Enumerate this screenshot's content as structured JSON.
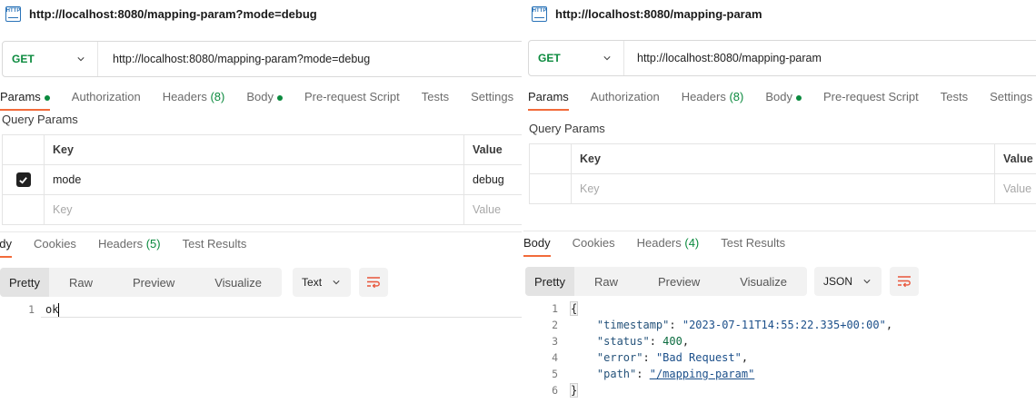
{
  "left": {
    "title": "http://localhost:8080/mapping-param?mode=debug",
    "method": "GET",
    "url": "http://localhost:8080/mapping-param?mode=debug",
    "request_tabs": [
      {
        "label": "Params",
        "dot": true
      },
      {
        "label": "Authorization"
      },
      {
        "label": "Headers",
        "count": "(8)"
      },
      {
        "label": "Body",
        "dot": true
      },
      {
        "label": "Pre-request Script"
      },
      {
        "label": "Tests"
      },
      {
        "label": "Settings"
      }
    ],
    "query_params_label": "Query Params",
    "table": {
      "key_header": "Key",
      "value_header": "Value",
      "rows": [
        {
          "key": "mode",
          "value": "debug",
          "checked": true
        }
      ],
      "key_placeholder": "Key",
      "value_placeholder": "Value"
    },
    "response_tabs": [
      {
        "label": "ody"
      },
      {
        "label": "Cookies"
      },
      {
        "label": "Headers",
        "count": "(5)"
      },
      {
        "label": "Test Results"
      }
    ],
    "view_modes": [
      "Pretty",
      "Raw",
      "Preview",
      "Visualize"
    ],
    "format": "Text",
    "body_lines": [
      {
        "n": "1",
        "text": "ok"
      }
    ]
  },
  "right": {
    "title": "http://localhost:8080/mapping-param",
    "method": "GET",
    "url": "http://localhost:8080/mapping-param",
    "request_tabs": [
      {
        "label": "Params"
      },
      {
        "label": "Authorization"
      },
      {
        "label": "Headers",
        "count": "(8)"
      },
      {
        "label": "Body",
        "dot": true
      },
      {
        "label": "Pre-request Script"
      },
      {
        "label": "Tests"
      },
      {
        "label": "Settings"
      }
    ],
    "query_params_label": "Query Params",
    "table": {
      "key_header": "Key",
      "value_header": "Value",
      "key_placeholder": "Key",
      "value_placeholder": "Value"
    },
    "response_tabs": [
      {
        "label": "Body"
      },
      {
        "label": "Cookies"
      },
      {
        "label": "Headers",
        "count": "(4)"
      },
      {
        "label": "Test Results"
      }
    ],
    "view_modes": [
      "Pretty",
      "Raw",
      "Preview",
      "Visualize"
    ],
    "format": "JSON",
    "json": {
      "open": "{",
      "close": "}",
      "entries": [
        {
          "key": "\"timestamp\"",
          "value": "\"2023-07-11T14:55:22.335+00:00\"",
          "kind": "str",
          "comma": ","
        },
        {
          "key": "\"status\"",
          "value": "400",
          "kind": "num",
          "comma": ","
        },
        {
          "key": "\"error\"",
          "value": "\"Bad Request\"",
          "kind": "str",
          "comma": ","
        },
        {
          "key": "\"path\"",
          "value": "\"/mapping-param\"",
          "kind": "link",
          "comma": ""
        }
      ],
      "line_numbers": [
        "1",
        "2",
        "3",
        "4",
        "5",
        "6"
      ]
    }
  },
  "colors": {
    "accent": "#f26b3a",
    "method": "#0b8a3e",
    "status_dot": "#0b8a3e"
  },
  "icons": {
    "title": "http-file-icon",
    "dropdown": "chevron-down-icon",
    "wrap": "wrap-lines-icon",
    "check": "check-icon"
  }
}
